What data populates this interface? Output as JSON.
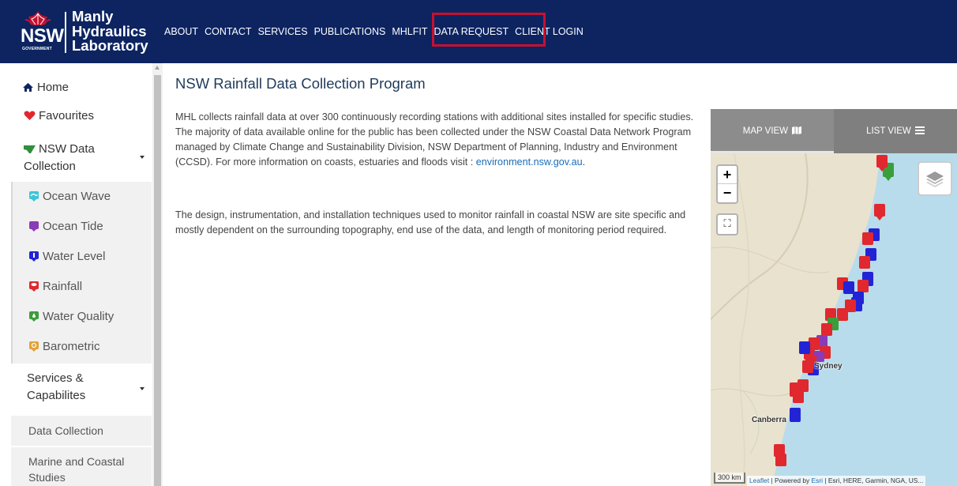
{
  "header": {
    "logo": {
      "nsw": "NSW",
      "government": "GOVERNMENT",
      "line1": "Manly",
      "line2": "Hydraulics",
      "line3": "Laboratory"
    },
    "nav": [
      "ABOUT",
      "CONTACT",
      "SERVICES",
      "PUBLICATIONS",
      "MHLFIT",
      "DATA REQUEST",
      "CLIENT LOGIN"
    ],
    "highlight_color": "#c8102e"
  },
  "sidebar": {
    "home": "Home",
    "favourites": "Favourites",
    "nsw_data_collection": "NSW Data Collection",
    "subitems": [
      "Ocean Wave",
      "Ocean Tide",
      "Water Level",
      "Rainfall",
      "Water Quality",
      "Barometric"
    ],
    "services": "Services & Capabilites",
    "services_items": [
      "Data Collection",
      "Marine and Coastal Studies"
    ]
  },
  "main": {
    "title": "NSW Rainfall Data Collection Program",
    "para1": "MHL collects rainfall data at over 300 continuously recording stations with additional sites installed for specific studies. The majority of data available online for the public has been collected under the NSW Coastal Data Network Program managed by Climate Change and Sustainability Division, NSW Department of Planning, Industry and Environment (CCSD). For more information on coasts, estuaries and floods visit : ",
    "para1_link": "environment.nsw.gov.au",
    "para1_end": ".",
    "para2": "The design, instrumentation, and installation techniques used to monitor rainfall in coastal NSW are site specific and mostly dependent on the surrounding topography, end use of the data, and length of monitoring period required."
  },
  "map": {
    "tab_map": "MAP VIEW",
    "tab_list": "LIST VIEW",
    "zoom_in": "+",
    "zoom_out": "−",
    "fullscreen_icon": "⛶",
    "scale": "300 km",
    "attribution_leaflet": "Leaflet",
    "attribution_mid": " | Powered by ",
    "attribution_esri": "Esri",
    "attribution_rest": " | Esri, HERE, Garmin, NGA, US...",
    "city_sydney": "Sydney",
    "city_canberra": "Canberra"
  },
  "colors": {
    "header_bg": "#0d2461",
    "rain_red": "#e0282e",
    "level_blue": "#2323d6",
    "quality_green": "#3a9e3a",
    "tide_purple": "#8a3bb8",
    "ocean_cyan": "#3cc5d9",
    "baro_orange": "#e2a23a"
  }
}
